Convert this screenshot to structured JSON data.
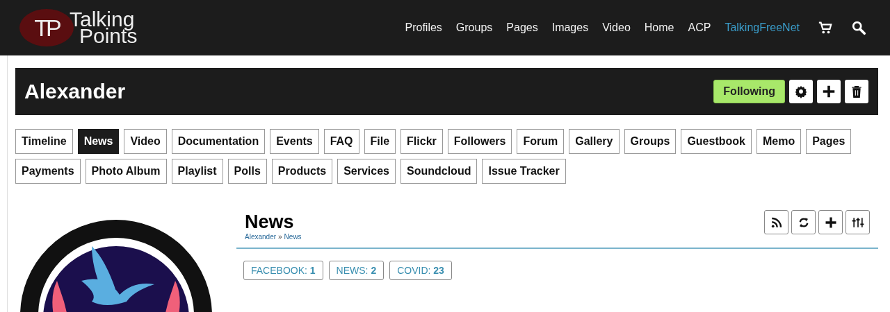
{
  "header": {
    "logo_mark": "TP",
    "logo_line1": "Talking",
    "logo_line2": "Points",
    "nav": [
      {
        "label": "Profiles",
        "highlighted": false
      },
      {
        "label": "Groups",
        "highlighted": false
      },
      {
        "label": "Pages",
        "highlighted": false
      },
      {
        "label": "Images",
        "highlighted": false
      },
      {
        "label": "Video",
        "highlighted": false
      },
      {
        "label": "Home",
        "highlighted": false
      },
      {
        "label": "ACP",
        "highlighted": false
      },
      {
        "label": "TalkingFreeNet",
        "highlighted": true
      }
    ]
  },
  "profile": {
    "name": "Alexander",
    "follow_button": "Following"
  },
  "tab_rows": [
    [
      {
        "label": "Timeline",
        "selected": false
      },
      {
        "label": "News",
        "selected": true
      },
      {
        "label": "Video",
        "selected": false
      },
      {
        "label": "Documentation",
        "selected": false
      },
      {
        "label": "Events",
        "selected": false
      },
      {
        "label": "FAQ",
        "selected": false
      },
      {
        "label": "File",
        "selected": false
      },
      {
        "label": "Flickr",
        "selected": false
      },
      {
        "label": "Followers",
        "selected": false
      },
      {
        "label": "Forum",
        "selected": false
      },
      {
        "label": "Gallery",
        "selected": false
      },
      {
        "label": "Groups",
        "selected": false
      },
      {
        "label": "Guestbook",
        "selected": false
      },
      {
        "label": "Memo",
        "selected": false
      },
      {
        "label": "Pages",
        "selected": false
      }
    ],
    [
      {
        "label": "Payments",
        "selected": false
      },
      {
        "label": "Photo Album",
        "selected": false
      },
      {
        "label": "Playlist",
        "selected": false
      },
      {
        "label": "Polls",
        "selected": false
      },
      {
        "label": "Products",
        "selected": false
      },
      {
        "label": "Services",
        "selected": false
      },
      {
        "label": "Soundcloud",
        "selected": false
      },
      {
        "label": "Issue Tracker",
        "selected": false
      }
    ]
  ],
  "section": {
    "title": "News",
    "breadcrumb": [
      {
        "label": "Alexander"
      },
      {
        "label": "News"
      }
    ],
    "breadcrumb_separator": "»",
    "tags": [
      {
        "label": "FACEBOOK:",
        "count": "1"
      },
      {
        "label": "NEWS:",
        "count": "2"
      },
      {
        "label": "COVID:",
        "count": "23"
      }
    ]
  }
}
